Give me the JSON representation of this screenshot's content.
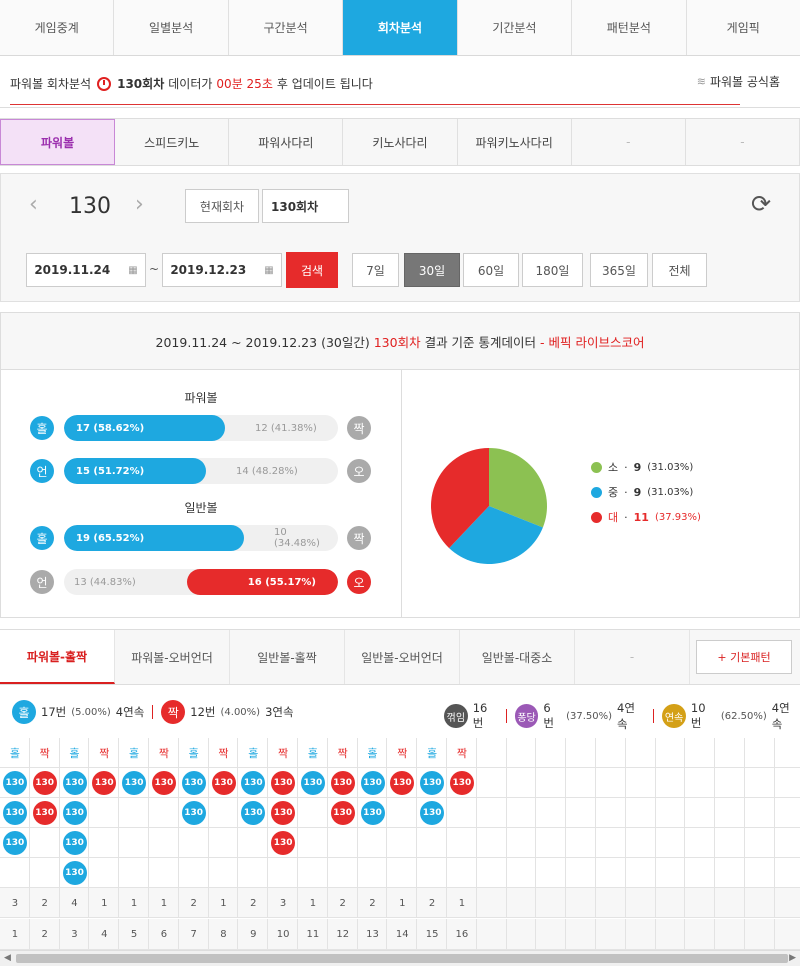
{
  "topnav": [
    "게임중계",
    "일별분석",
    "구간분석",
    "회차분석",
    "기간분석",
    "패턴분석",
    "게임픽"
  ],
  "info": {
    "prefix": "파워볼 회차분석",
    "round": "130회차",
    "mid": "데이터가",
    "time": "00분 25초",
    "suffix": "후 업데이트 됩니다",
    "official": "파워볼 공식홈"
  },
  "gametabs": [
    "파워볼",
    "스피드키노",
    "파워사다리",
    "키노사다리",
    "파워키노사다리",
    "-",
    "-"
  ],
  "search": {
    "round": "130",
    "current_btn": "현재회차",
    "round_field": "130회차",
    "date_from": "2019.11.24",
    "date_to": "2019.12.23",
    "tilde": "~",
    "search_btn": "검색",
    "days": [
      "7일",
      "30일",
      "60일",
      "180일",
      "365일",
      "전체"
    ]
  },
  "stats": {
    "head_period": "2019.11.24 ~ 2019.12.23 (30일간)",
    "head_round": "130회차",
    "head_mid": "결과 기준 통계데이터",
    "head_brand": "- 베픽 라이브스코어",
    "pb_label": "파워볼",
    "nb_label": "일반볼",
    "rows": [
      {
        "left": "홀",
        "left_val": "17 (58.62%)",
        "right_val": "12 (41.38%)",
        "right": "짝",
        "fill": 0.5862,
        "side": "left"
      },
      {
        "left": "언",
        "left_val": "15 (51.72%)",
        "right_val": "14 (48.28%)",
        "right": "오",
        "fill": 0.5172,
        "side": "left"
      },
      {
        "left": "홀",
        "left_val": "19 (65.52%)",
        "right_val": "10 (34.48%)",
        "right": "짝",
        "fill": 0.6552,
        "side": "left"
      },
      {
        "left": "언",
        "left_val": "13 (44.83%)",
        "right_val": "16 (55.17%)",
        "right": "오",
        "fill": 0.5517,
        "side": "right"
      }
    ],
    "legend": [
      {
        "name": "소",
        "val": "9",
        "pct": "(31.03%)",
        "color": "#8cc152"
      },
      {
        "name": "중",
        "val": "9",
        "pct": "(31.03%)",
        "color": "#1ea8e0"
      },
      {
        "name": "대",
        "val": "11",
        "pct": "(37.93%)",
        "color": "#e62b2b"
      }
    ]
  },
  "ptabs": [
    "파워볼-홀짝",
    "파워볼-오버언더",
    "일반볼-홀짝",
    "일반볼-오버언더",
    "일반볼-대중소",
    "-"
  ],
  "basic_btn": "+ 기본패턴",
  "summary": {
    "odd": {
      "b": "홀",
      "v": "17번",
      "p": "(5.00%)",
      "s": "4연속"
    },
    "even": {
      "b": "짝",
      "v": "12번",
      "p": "(4.00%)",
      "s": "3연속"
    },
    "turn": {
      "b": "꺾임",
      "v": "16번"
    },
    "pong": {
      "b": "퐁당",
      "v": "6번",
      "p": "(37.50%)",
      "s": "4연속"
    },
    "cont": {
      "b": "연속",
      "v": "10번",
      "p": "(62.50%)",
      "s": "4연속"
    }
  },
  "grid": {
    "cols": [
      {
        "h": "홀",
        "n": 3
      },
      {
        "h": "짝",
        "n": 2
      },
      {
        "h": "홀",
        "n": 4
      },
      {
        "h": "짝",
        "n": 1
      },
      {
        "h": "홀",
        "n": 1
      },
      {
        "h": "짝",
        "n": 1
      },
      {
        "h": "홀",
        "n": 2
      },
      {
        "h": "짝",
        "n": 1
      },
      {
        "h": "홀",
        "n": 2
      },
      {
        "h": "짝",
        "n": 3
      },
      {
        "h": "홀",
        "n": 1
      },
      {
        "h": "짝",
        "n": 2
      },
      {
        "h": "홀",
        "n": 2
      },
      {
        "h": "짝",
        "n": 1
      },
      {
        "h": "홀",
        "n": 2
      },
      {
        "h": "짝",
        "n": 1
      }
    ],
    "ball": "130",
    "idx": [
      "1",
      "2",
      "3",
      "4",
      "5",
      "6",
      "7",
      "8",
      "9",
      "10",
      "11",
      "12",
      "13",
      "14",
      "15",
      "16"
    ]
  },
  "colors": {
    "blue": "#1ea8e0",
    "red": "#e62b2b",
    "gray": "#aaaaaa"
  }
}
